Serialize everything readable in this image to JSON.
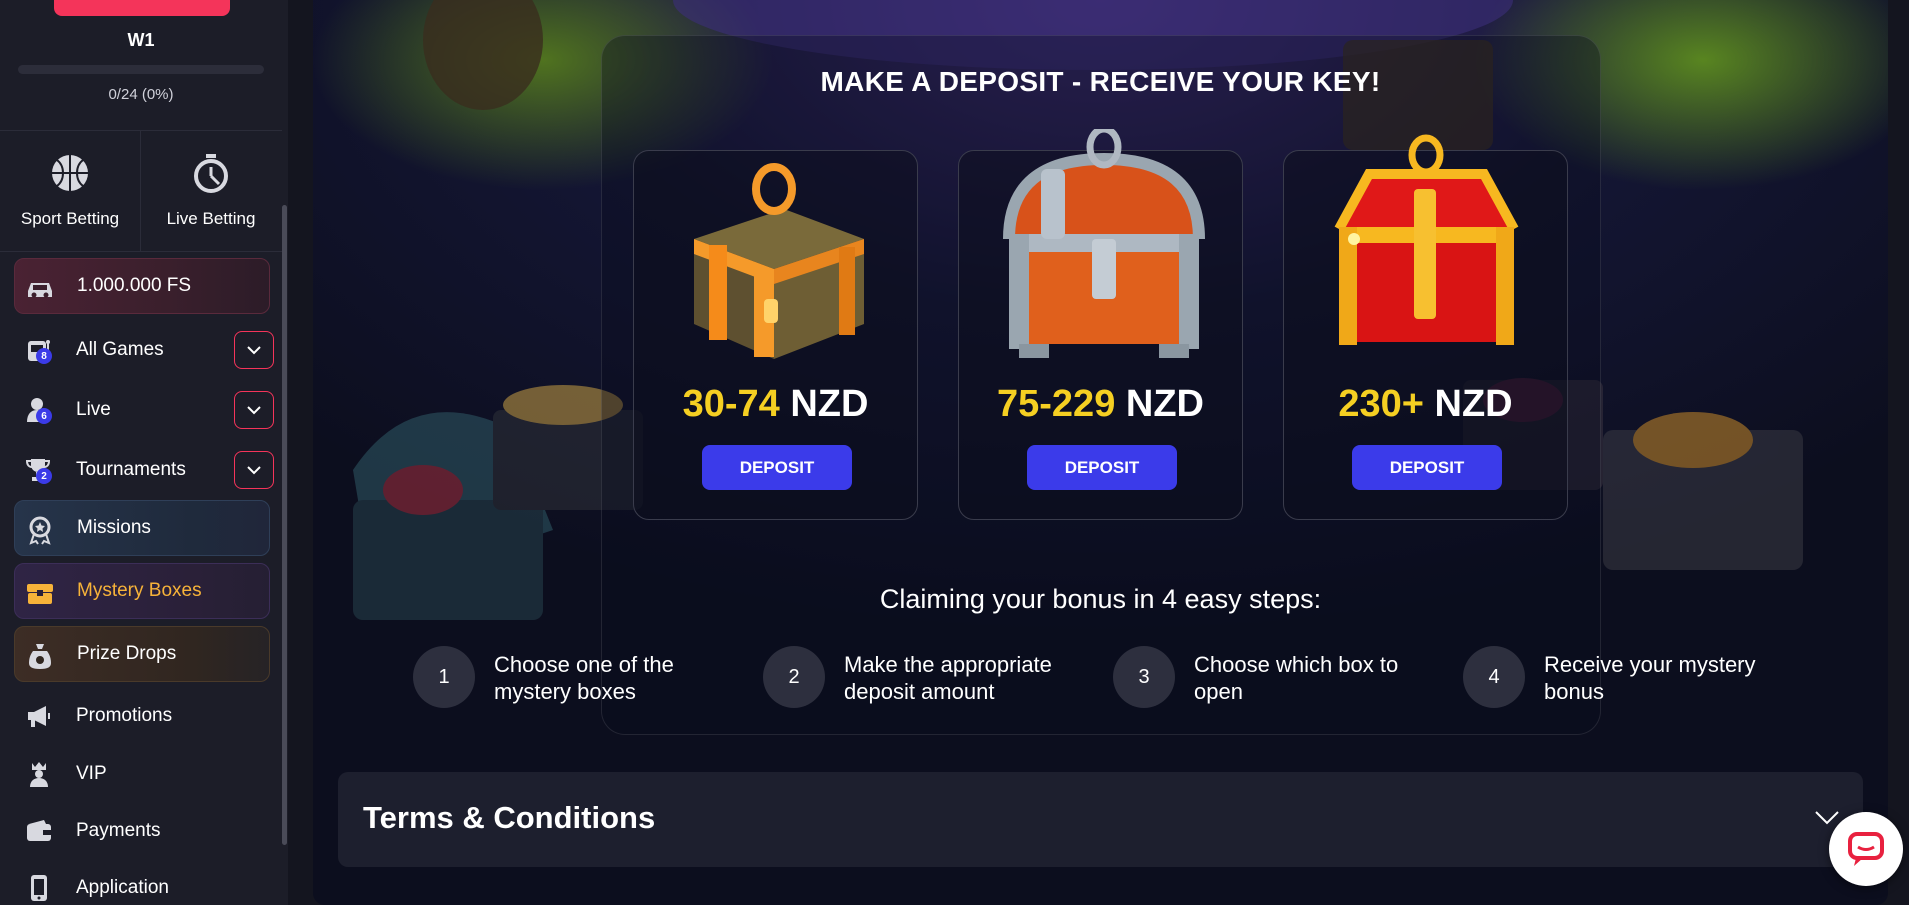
{
  "sidebar": {
    "level": {
      "label": "W1",
      "progress_text": "0/24 (0%)",
      "progress_fraction": 0
    },
    "bet_tiles": [
      {
        "label": "Sport Betting",
        "icon": "basketball-icon"
      },
      {
        "label": "Live Betting",
        "icon": "stopwatch-icon"
      }
    ],
    "items": [
      {
        "label": "1.000.000 FS",
        "icon": "car-icon"
      },
      {
        "label": "All Games",
        "icon": "slot-machine-icon",
        "badge": "8"
      },
      {
        "label": "Live",
        "icon": "dealer-icon",
        "badge": "6"
      },
      {
        "label": "Tournaments",
        "icon": "trophy-icon",
        "badge": "2"
      },
      {
        "label": "Missions",
        "icon": "medal-icon"
      },
      {
        "label": "Mystery Boxes",
        "icon": "treasure-box-icon"
      },
      {
        "label": "Prize Drops",
        "icon": "prize-bag-icon"
      },
      {
        "label": "Promotions",
        "icon": "megaphone-icon"
      },
      {
        "label": "VIP",
        "icon": "king-icon"
      },
      {
        "label": "Payments",
        "icon": "wallet-icon"
      },
      {
        "label": "Application",
        "icon": "phone-app-icon"
      }
    ]
  },
  "main": {
    "title": "MAKE A DEPOSIT - RECEIVE YOUR KEY!",
    "boxes": [
      {
        "range": "30-74",
        "currency": "NZD",
        "button": "DEPOSIT",
        "type": "wooden"
      },
      {
        "range": "75-229",
        "currency": "NZD",
        "button": "DEPOSIT",
        "type": "silver"
      },
      {
        "range": "230+",
        "currency": "NZD",
        "button": "DEPOSIT",
        "type": "golden"
      }
    ],
    "steps_title": "Claiming your bonus in 4 easy steps:",
    "steps": [
      {
        "num": "1",
        "text": "Choose one of the mystery boxes"
      },
      {
        "num": "2",
        "text": "Make the appropriate deposit amount"
      },
      {
        "num": "3",
        "text": "Choose which box to open"
      },
      {
        "num": "4",
        "text": "Receive your mystery bonus"
      }
    ],
    "terms_title": "Terms & Conditions"
  },
  "colors": {
    "accent": "#f4345a",
    "button": "#3b3bea",
    "price": "#f5cf22",
    "mystery_active": "#f7b339"
  }
}
